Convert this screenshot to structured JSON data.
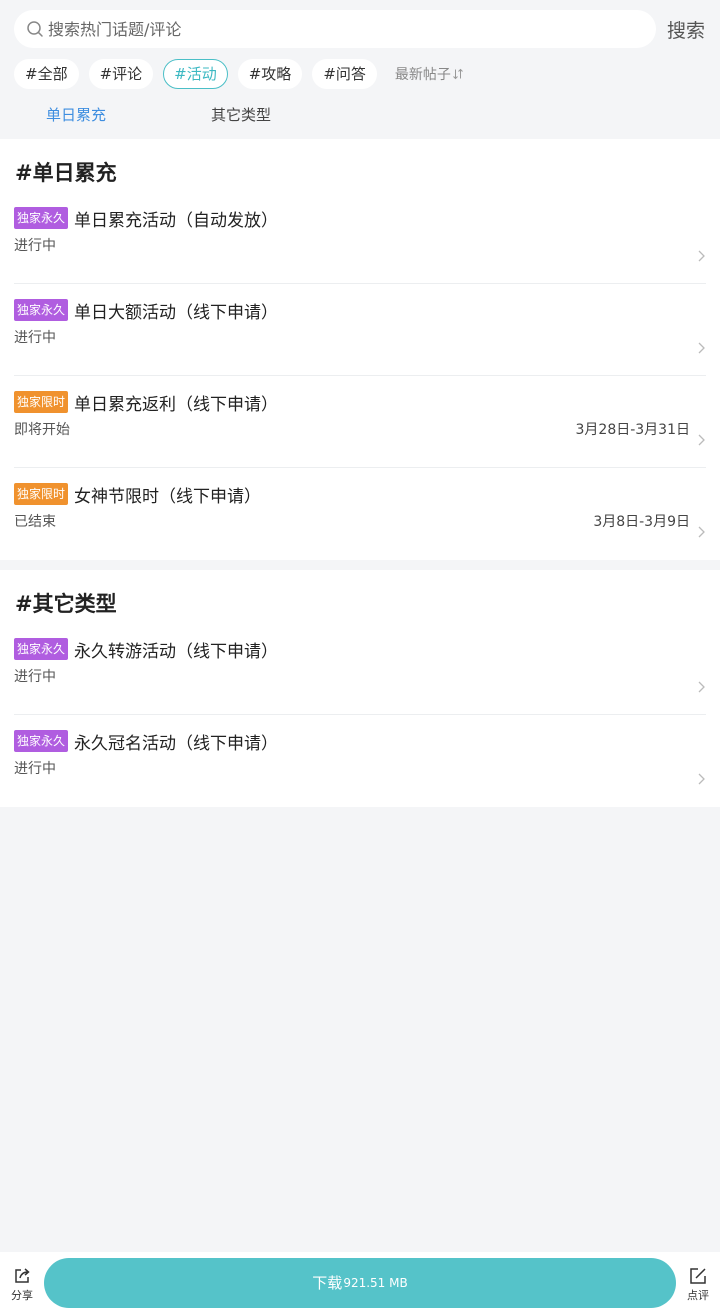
{
  "search": {
    "placeholder": "搜索热门话题/评论",
    "button": "搜索"
  },
  "tags": [
    "#全部",
    "#评论",
    "#活动",
    "#攻略",
    "#问答"
  ],
  "active_tag": "#活动",
  "sort": {
    "label": "最新帖子"
  },
  "subtabs": [
    "单日累充",
    "其它类型"
  ],
  "sections": [
    {
      "title": "#单日累充",
      "items": [
        {
          "badge": "独家永久",
          "title": "单日累充活动（自动发放）",
          "status": "进行中",
          "date": ""
        },
        {
          "badge": "独家永久",
          "title": "单日大额活动（线下申请）",
          "status": "进行中",
          "date": ""
        },
        {
          "badge": "独家限时",
          "title": "单日累充返利（线下申请）",
          "status": "即将开始",
          "date": "3月28日-3月31日"
        },
        {
          "badge": "独家限时",
          "title": "女神节限时（线下申请）",
          "status": "已结束",
          "date": "3月8日-3月9日"
        }
      ]
    },
    {
      "title": "#其它类型",
      "items": [
        {
          "badge": "独家永久",
          "title": "永久转游活动（线下申请）",
          "status": "进行中",
          "date": ""
        },
        {
          "badge": "独家永久",
          "title": "永久冠名活动（线下申请）",
          "status": "进行中",
          "date": ""
        }
      ]
    }
  ],
  "bottom": {
    "share": "分享",
    "download_label": "下载",
    "download_size": "921.51 MB",
    "review": "点评"
  },
  "colors": {
    "accent": "#55c3c9",
    "badge_permanent": "#b05de0",
    "badge_limited": "#f0922e",
    "subtab_active": "#3e8ee0"
  }
}
